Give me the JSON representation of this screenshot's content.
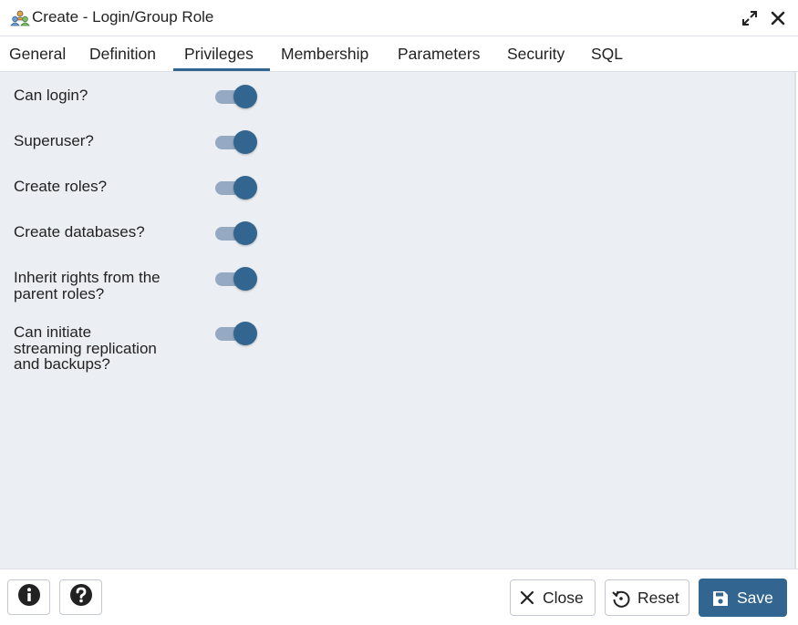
{
  "dialog": {
    "title": "Create - Login/Group Role",
    "title_icon": "roles-icon",
    "expand_icon": "expand-icon",
    "close_icon": "close-icon"
  },
  "tabs": [
    {
      "label": "General",
      "active": false
    },
    {
      "label": "Definition",
      "active": false
    },
    {
      "label": "Privileges",
      "active": true
    },
    {
      "label": "Membership",
      "active": false
    },
    {
      "label": "Parameters",
      "active": false
    },
    {
      "label": "Security",
      "active": false
    },
    {
      "label": "SQL",
      "active": false
    }
  ],
  "privileges": [
    {
      "lines": [
        "Can login?"
      ],
      "enabled": true
    },
    {
      "lines": [
        "Superuser?"
      ],
      "enabled": true
    },
    {
      "lines": [
        "Create roles?"
      ],
      "enabled": true
    },
    {
      "lines": [
        "Create databases?"
      ],
      "enabled": true
    },
    {
      "lines": [
        "Inherit rights from the",
        "parent roles?"
      ],
      "enabled": true
    },
    {
      "lines": [
        "Can initiate",
        "streaming replication",
        "and backups?"
      ],
      "enabled": true
    }
  ],
  "footer": {
    "info_icon": "info-icon",
    "help_icon": "help-icon",
    "close_label": "Close",
    "reset_label": "Reset",
    "save_label": "Save"
  },
  "colors": {
    "accent": "#326690",
    "toggle_track": "#95a9c2",
    "panel_background": "#ebeef3",
    "border": "#dde0e6"
  }
}
